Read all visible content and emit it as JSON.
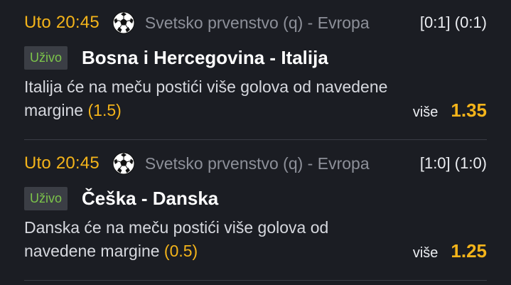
{
  "bets": [
    {
      "time": "Uto 20:45",
      "competition": "Svetsko prvenstvo (q) - Evropa",
      "score": "[0:1] (0:1)",
      "live_label": "Uživo",
      "match": "Bosna i Hercegovina - Italija",
      "description": "Italija će na meču postići više golova od navedene margine",
      "margin": "(1.5)",
      "odds_label": "više",
      "odds": "1.35",
      "icon": "soccer-ball-icon"
    },
    {
      "time": "Uto 20:45",
      "competition": "Svetsko prvenstvo (q) - Evropa",
      "score": "[1:0] (1:0)",
      "live_label": "Uživo",
      "match": "Češka - Danska",
      "description": "Danska će na meču postići više golova od navedene margine",
      "margin": "(0.5)",
      "odds_label": "više",
      "odds": "1.25",
      "icon": "soccer-ball-icon"
    }
  ],
  "colors": {
    "background": "#1b1d23",
    "accent": "#f4b41a",
    "live_text": "#7cc44a",
    "live_bg": "#3b3e45",
    "muted": "#8d9099"
  }
}
